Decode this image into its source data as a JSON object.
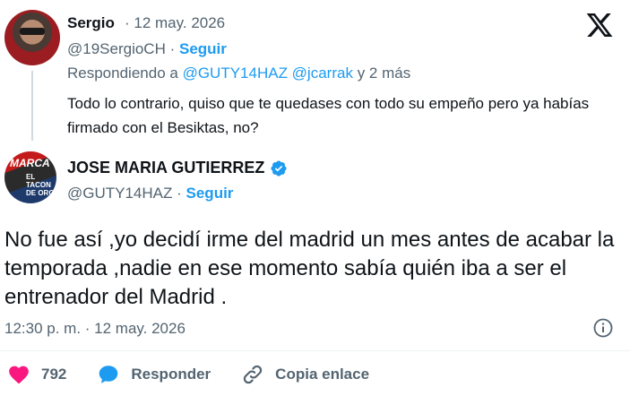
{
  "reply_tweet": {
    "author_name": "Sergio",
    "date": "· 12 may. 2026",
    "handle": "@19SergioCH",
    "follow_label": "Seguir",
    "replying_prefix": "Respondiendo a",
    "replying_mentions": "@GUTY14HAZ @jcarrak",
    "replying_suffix": "y 2 más",
    "text": "Todo lo contrario, quiso que te quedases con todo su empeño pero ya habías firmado con el Besiktas, no?"
  },
  "main_tweet": {
    "author_name": "JOSE MARIA GUTIERREZ",
    "handle": "@GUTY14HAZ",
    "follow_label": "Seguir",
    "avatar_text_top": "MARCA",
    "avatar_text_bottom": "EL TACON DE ORO",
    "text": "No fue así ,yo decidí irme del madrid un mes antes de acabar la temporada ,nadie en ese momento sabía quién iba a ser el entrenador del Madrid .",
    "timestamp": "12:30 p. m. · 12 may. 2026"
  },
  "actions": {
    "like_count": "792",
    "reply_label": "Responder",
    "copy_link_label": "Copia enlace"
  },
  "colors": {
    "accent": "#1d9bf0",
    "like": "#f91880",
    "muted": "#536471"
  }
}
